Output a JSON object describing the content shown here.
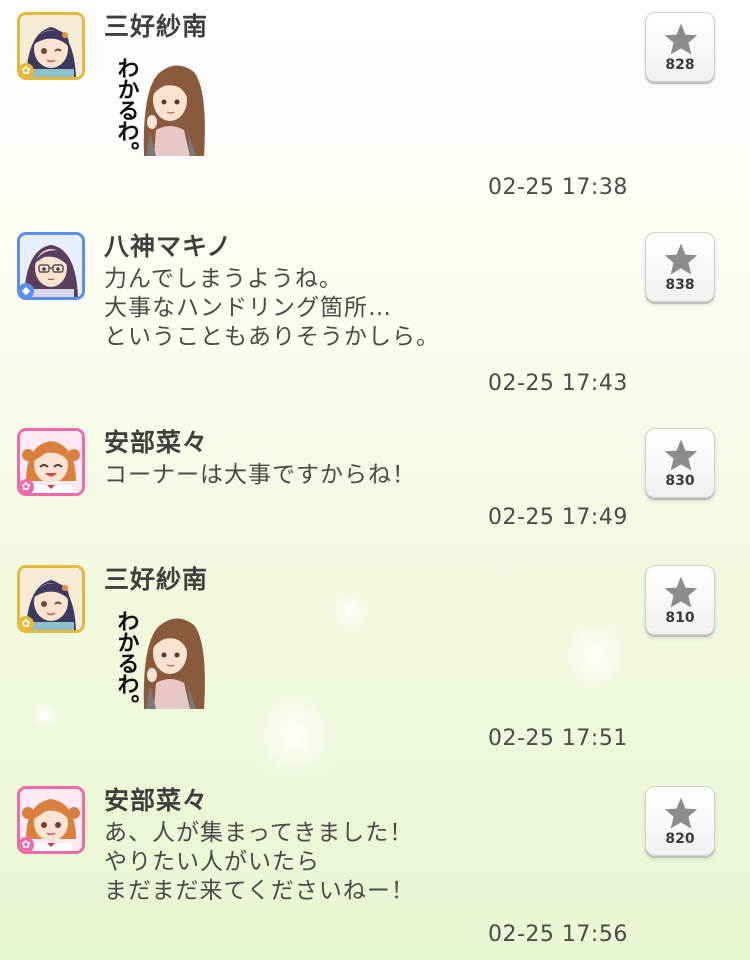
{
  "messages": [
    {
      "name": "三好紗南",
      "avatar_icon": "sana-avatar-icon",
      "attribute": "passion",
      "type": "stamp",
      "stamp_text": "わかるわ。",
      "text": "",
      "time": "02-25 17:38",
      "likes": "828"
    },
    {
      "name": "八神マキノ",
      "avatar_icon": "makino-avatar-icon",
      "attribute": "cool",
      "type": "text",
      "text": "力んでしまうようね。\n大事なハンドリング箇所…\nということもありそうかしら。",
      "time": "02-25 17:43",
      "likes": "838"
    },
    {
      "name": "安部菜々",
      "avatar_icon": "nana-avatar-icon",
      "attribute": "cute",
      "type": "text",
      "text": "コーナーは大事ですからね！",
      "time": "02-25 17:49",
      "likes": "830"
    },
    {
      "name": "三好紗南",
      "avatar_icon": "sana-avatar-icon",
      "attribute": "passion",
      "type": "stamp",
      "stamp_text": "わかるわ。",
      "text": "",
      "time": "02-25 17:51",
      "likes": "810"
    },
    {
      "name": "安部菜々",
      "avatar_icon": "nana-avatar-icon",
      "attribute": "cute",
      "type": "text",
      "text": "あ、人が集まってきました！\nやりたい人がいたら\nまだまだ来てくださいねー！",
      "time": "02-25 17:56",
      "likes": "820"
    }
  ],
  "colors": {
    "passion": "#e8b83a",
    "cool": "#5b8ef0",
    "cute": "#ef6aa8",
    "star": "#8c8c8c"
  }
}
